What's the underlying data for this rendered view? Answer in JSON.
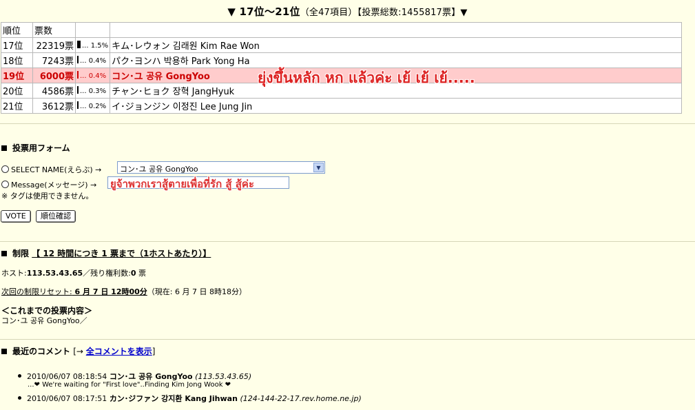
{
  "header": {
    "title": "▼ 17位〜21位",
    "subtitle": "（全47項目）【投票総数:1455817票】▼"
  },
  "table": {
    "headers": [
      "順位",
      "票数"
    ],
    "rows": [
      {
        "rank": "17位",
        "votes": "22319票",
        "bar_label": "... 1.5%",
        "pct": 1.5,
        "name": "キム･レウォン 김래원 Kim Rae Won",
        "highlight": false
      },
      {
        "rank": "18位",
        "votes": "7243票",
        "bar_label": "... 0.4%",
        "pct": 0.4,
        "name": "パク･ヨンハ 박용하 Park Yong Ha",
        "highlight": false
      },
      {
        "rank": "19位",
        "votes": "6000票",
        "bar_label": "... 0.4%",
        "pct": 0.4,
        "name": "コン･ユ 공유 GongYoo",
        "highlight": true
      },
      {
        "rank": "20位",
        "votes": "4586票",
        "bar_label": "... 0.3%",
        "pct": 0.3,
        "name": "チャン･ヒョク 장혁 JangHyuk",
        "highlight": false
      },
      {
        "rank": "21位",
        "votes": "3612票",
        "bar_label": "... 0.2%",
        "pct": 0.2,
        "name": "イ･ジョンジン 이정진 Lee Jung Jin",
        "highlight": false
      }
    ]
  },
  "overlay": {
    "highlight_note": "ยุ่งขึ้นหลัก หก แล้วค่ะ เย้ เย้ เย้.....",
    "message_text": "ยูจ้าพวกเราสู้ตายเพื่อที่รัก สู้ สู้ค่ะ"
  },
  "form": {
    "heading": "投票用フォーム",
    "select_label": "SELECT NAME(えらぶ) →",
    "select_value": "コン･ユ 공유 GongYoo",
    "message_label": "Message(メッセージ) →",
    "note": "※ タグは使用できません。",
    "vote_button": "VOTE",
    "rank_button": "順位確認"
  },
  "limit": {
    "heading_prefix": "制限",
    "heading_rule": "【 12 時間につき 1 票まで（1ホストあたり）】",
    "host_label": "ホスト:",
    "host_value": "113.53.43.65",
    "remaining_label": "／残り権利数:",
    "remaining_value": "0",
    "remaining_unit": " 票",
    "reset_label": "次回の制限リセット:",
    "reset_value": " 6 月 7 日 12時00分",
    "reset_now": "（現在: 6 月 7 日 8時18分）",
    "history_heading": "＜これまでの投票内容＞",
    "history_value": "コン･ユ 공유 GongYoo／"
  },
  "comments": {
    "heading": "最近のコメント",
    "bracket_open": "[→ ",
    "link_label": "全コメントを表示",
    "bracket_close": "]",
    "items": [
      {
        "time": "2010/06/07 08:18:54",
        "name": "コン･ユ 공유 GongYoo",
        "ip": "(113.53.43.65)",
        "text": "...❤ We're waiting for \"First love\"..Finding Kim Jong Wook ❤"
      },
      {
        "time": "2010/06/07 08:17:51",
        "name": "カン･ジファン 강지환 Kang Jihwan",
        "ip": "(124-144-22-17.rev.home.ne.jp)",
        "text": ""
      }
    ]
  }
}
